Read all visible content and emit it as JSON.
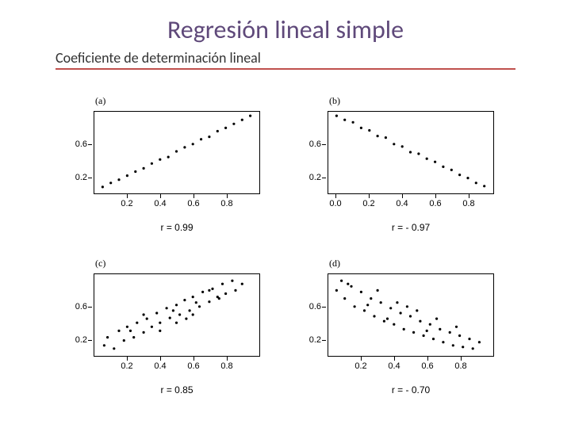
{
  "title": "Regresión lineal simple",
  "subtitle": "Coeficiente de determinación lineal",
  "axis": {
    "x_ticks": [
      "0.2",
      "0.4",
      "0.6",
      "0.8"
    ],
    "y_ticks": [
      "0.2",
      "0.6"
    ],
    "xa_ticks": [
      "0.0",
      "0.2",
      "0.4",
      "0.6",
      "0.8"
    ]
  },
  "panels": {
    "a": {
      "label": "(a)",
      "r_label": "r = 0.99"
    },
    "b": {
      "label": "(b)",
      "r_label": "r = - 0.97"
    },
    "c": {
      "label": "(c)",
      "r_label": "r = 0.85"
    },
    "d": {
      "label": "(d)",
      "r_label": "r = - 0.70"
    }
  },
  "chart_data": [
    {
      "id": "a",
      "type": "scatter",
      "title": "(a)",
      "xlim": [
        0,
        1
      ],
      "ylim": [
        0,
        1
      ],
      "x_ticks": [
        0.2,
        0.4,
        0.6,
        0.8
      ],
      "y_ticks": [
        0.2,
        0.6
      ],
      "r": 0.99,
      "r_label": "r = 0.99",
      "points": [
        [
          0.05,
          0.07
        ],
        [
          0.1,
          0.12
        ],
        [
          0.15,
          0.16
        ],
        [
          0.2,
          0.21
        ],
        [
          0.25,
          0.26
        ],
        [
          0.3,
          0.3
        ],
        [
          0.35,
          0.36
        ],
        [
          0.4,
          0.41
        ],
        [
          0.45,
          0.44
        ],
        [
          0.5,
          0.51
        ],
        [
          0.55,
          0.56
        ],
        [
          0.6,
          0.6
        ],
        [
          0.65,
          0.66
        ],
        [
          0.7,
          0.69
        ],
        [
          0.75,
          0.76
        ],
        [
          0.8,
          0.8
        ],
        [
          0.85,
          0.85
        ],
        [
          0.9,
          0.9
        ],
        [
          0.95,
          0.95
        ]
      ]
    },
    {
      "id": "b",
      "type": "scatter",
      "title": "(b)",
      "xlim": [
        -0.05,
        0.95
      ],
      "ylim": [
        0,
        1
      ],
      "x_ticks": [
        0.0,
        0.2,
        0.4,
        0.6,
        0.8
      ],
      "y_ticks": [
        0.2,
        0.6
      ],
      "r": -0.97,
      "r_label": "r = - 0.97",
      "points": [
        [
          0.0,
          0.95
        ],
        [
          0.05,
          0.9
        ],
        [
          0.1,
          0.87
        ],
        [
          0.15,
          0.8
        ],
        [
          0.2,
          0.77
        ],
        [
          0.25,
          0.7
        ],
        [
          0.3,
          0.68
        ],
        [
          0.35,
          0.6
        ],
        [
          0.4,
          0.57
        ],
        [
          0.45,
          0.5
        ],
        [
          0.5,
          0.48
        ],
        [
          0.55,
          0.42
        ],
        [
          0.6,
          0.38
        ],
        [
          0.65,
          0.32
        ],
        [
          0.7,
          0.28
        ],
        [
          0.75,
          0.22
        ],
        [
          0.8,
          0.18
        ],
        [
          0.85,
          0.12
        ],
        [
          0.9,
          0.08
        ]
      ]
    },
    {
      "id": "c",
      "type": "scatter",
      "title": "(c)",
      "xlim": [
        0,
        1
      ],
      "ylim": [
        0,
        1
      ],
      "x_ticks": [
        0.2,
        0.4,
        0.6,
        0.8
      ],
      "y_ticks": [
        0.2,
        0.6
      ],
      "r": 0.85,
      "r_label": "r = 0.85",
      "points": [
        [
          0.06,
          0.12
        ],
        [
          0.08,
          0.22
        ],
        [
          0.12,
          0.08
        ],
        [
          0.15,
          0.3
        ],
        [
          0.18,
          0.18
        ],
        [
          0.2,
          0.35
        ],
        [
          0.24,
          0.22
        ],
        [
          0.26,
          0.4
        ],
        [
          0.3,
          0.28
        ],
        [
          0.32,
          0.45
        ],
        [
          0.35,
          0.35
        ],
        [
          0.38,
          0.52
        ],
        [
          0.4,
          0.4
        ],
        [
          0.44,
          0.58
        ],
        [
          0.46,
          0.46
        ],
        [
          0.5,
          0.62
        ],
        [
          0.52,
          0.5
        ],
        [
          0.55,
          0.68
        ],
        [
          0.58,
          0.55
        ],
        [
          0.6,
          0.72
        ],
        [
          0.64,
          0.6
        ],
        [
          0.66,
          0.78
        ],
        [
          0.7,
          0.66
        ],
        [
          0.72,
          0.82
        ],
        [
          0.75,
          0.72
        ],
        [
          0.78,
          0.88
        ],
        [
          0.8,
          0.76
        ],
        [
          0.84,
          0.92
        ],
        [
          0.86,
          0.8
        ],
        [
          0.9,
          0.88
        ],
        [
          0.3,
          0.5
        ],
        [
          0.4,
          0.3
        ],
        [
          0.5,
          0.4
        ],
        [
          0.6,
          0.5
        ],
        [
          0.7,
          0.8
        ],
        [
          0.22,
          0.3
        ],
        [
          0.48,
          0.55
        ],
        [
          0.56,
          0.45
        ],
        [
          0.62,
          0.65
        ],
        [
          0.76,
          0.7
        ]
      ]
    },
    {
      "id": "d",
      "type": "scatter",
      "title": "(d)",
      "xlim": [
        0,
        1
      ],
      "ylim": [
        0,
        1
      ],
      "x_ticks": [
        0.2,
        0.4,
        0.6,
        0.8
      ],
      "y_ticks": [
        0.2,
        0.6
      ],
      "r": -0.7,
      "r_label": "r = - 0.70",
      "points": [
        [
          0.05,
          0.8
        ],
        [
          0.08,
          0.92
        ],
        [
          0.1,
          0.7
        ],
        [
          0.14,
          0.85
        ],
        [
          0.16,
          0.6
        ],
        [
          0.2,
          0.78
        ],
        [
          0.22,
          0.55
        ],
        [
          0.26,
          0.7
        ],
        [
          0.28,
          0.48
        ],
        [
          0.32,
          0.65
        ],
        [
          0.34,
          0.42
        ],
        [
          0.38,
          0.58
        ],
        [
          0.4,
          0.38
        ],
        [
          0.44,
          0.52
        ],
        [
          0.46,
          0.32
        ],
        [
          0.5,
          0.48
        ],
        [
          0.52,
          0.28
        ],
        [
          0.56,
          0.42
        ],
        [
          0.58,
          0.24
        ],
        [
          0.62,
          0.38
        ],
        [
          0.64,
          0.2
        ],
        [
          0.68,
          0.32
        ],
        [
          0.7,
          0.16
        ],
        [
          0.74,
          0.28
        ],
        [
          0.76,
          0.12
        ],
        [
          0.8,
          0.24
        ],
        [
          0.82,
          0.1
        ],
        [
          0.86,
          0.2
        ],
        [
          0.88,
          0.08
        ],
        [
          0.92,
          0.16
        ],
        [
          0.12,
          0.88
        ],
        [
          0.3,
          0.8
        ],
        [
          0.42,
          0.65
        ],
        [
          0.54,
          0.55
        ],
        [
          0.66,
          0.45
        ],
        [
          0.78,
          0.35
        ],
        [
          0.36,
          0.45
        ],
        [
          0.48,
          0.6
        ],
        [
          0.6,
          0.3
        ],
        [
          0.24,
          0.62
        ]
      ]
    }
  ]
}
